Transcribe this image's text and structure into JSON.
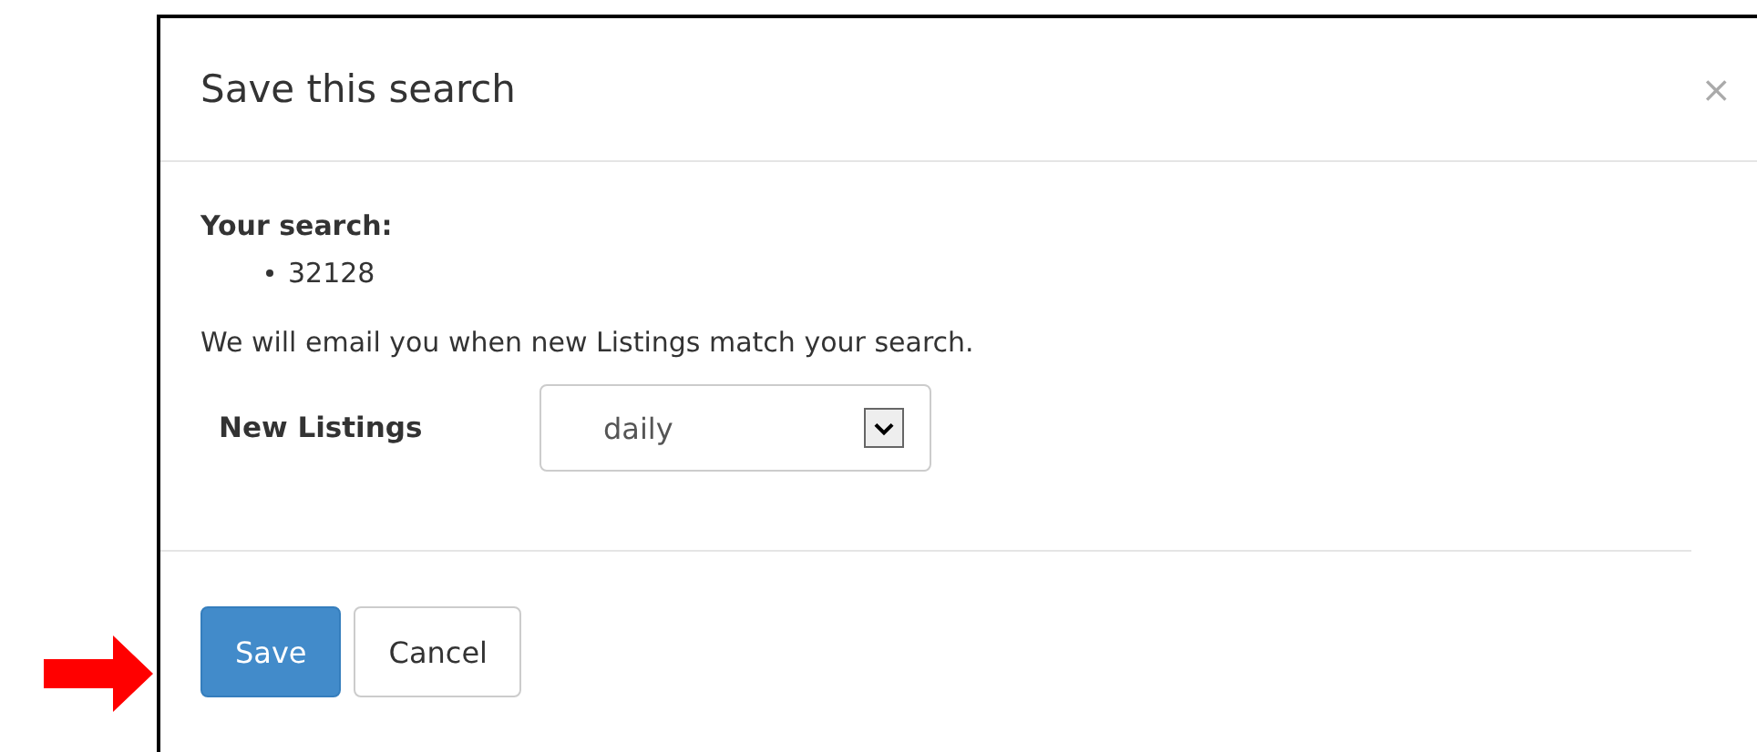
{
  "dialog": {
    "title": "Save this search",
    "close": "×"
  },
  "search_label": "Your search:",
  "search_terms": [
    "32128"
  ],
  "notice": "We will email you when new Listings match your search.",
  "frequency": {
    "label": "New Listings",
    "value": "daily"
  },
  "buttons": [
    {
      "label": "Save",
      "kind": "primary"
    },
    {
      "label": "Cancel",
      "kind": "default"
    }
  ]
}
